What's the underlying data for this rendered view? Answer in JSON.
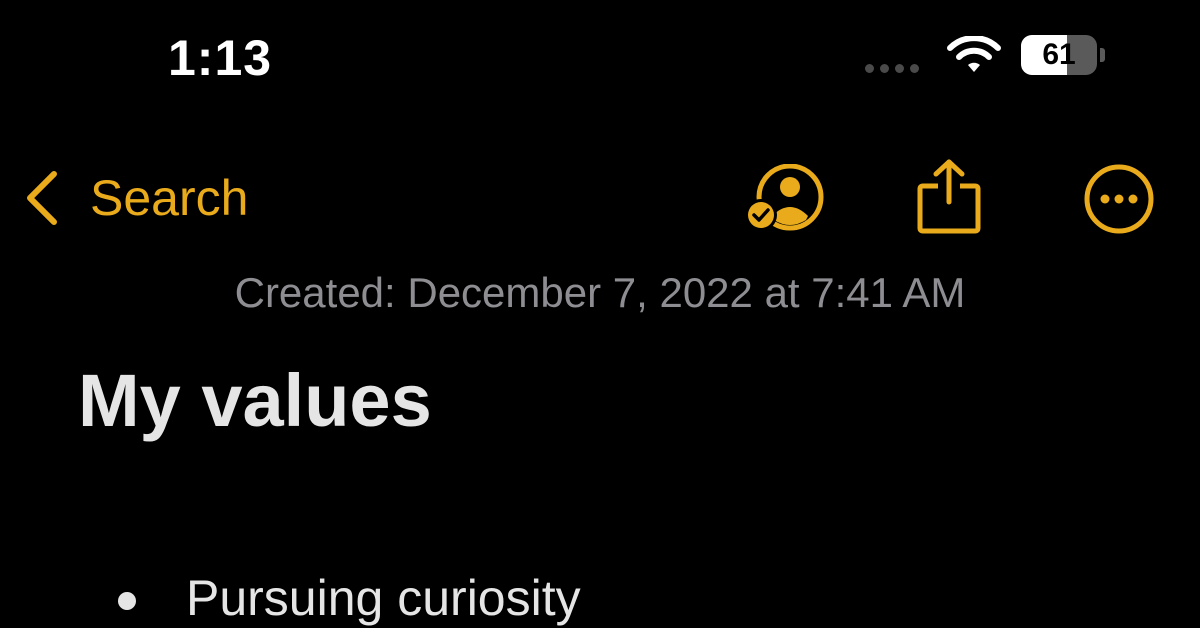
{
  "status_bar": {
    "time": "1:13",
    "battery_level": "61",
    "battery_fraction": 0.61,
    "wifi_icon": "wifi-icon",
    "cellular_icon": "cellular-dots-icon"
  },
  "nav": {
    "back_label": "Search",
    "back_icon": "chevron-left-icon",
    "collaborate_icon": "person-check-icon",
    "share_icon": "share-icon",
    "more_icon": "ellipsis-circle-icon"
  },
  "note": {
    "created": "Created: December 7, 2022 at 7:41 AM",
    "title": "My values",
    "items": [
      {
        "text": "Pursuing curiosity"
      }
    ]
  },
  "colors": {
    "background": "#000000",
    "accent": "#e9ab1b",
    "text_primary": "#e5e5e5",
    "text_secondary": "#8d8d92"
  }
}
